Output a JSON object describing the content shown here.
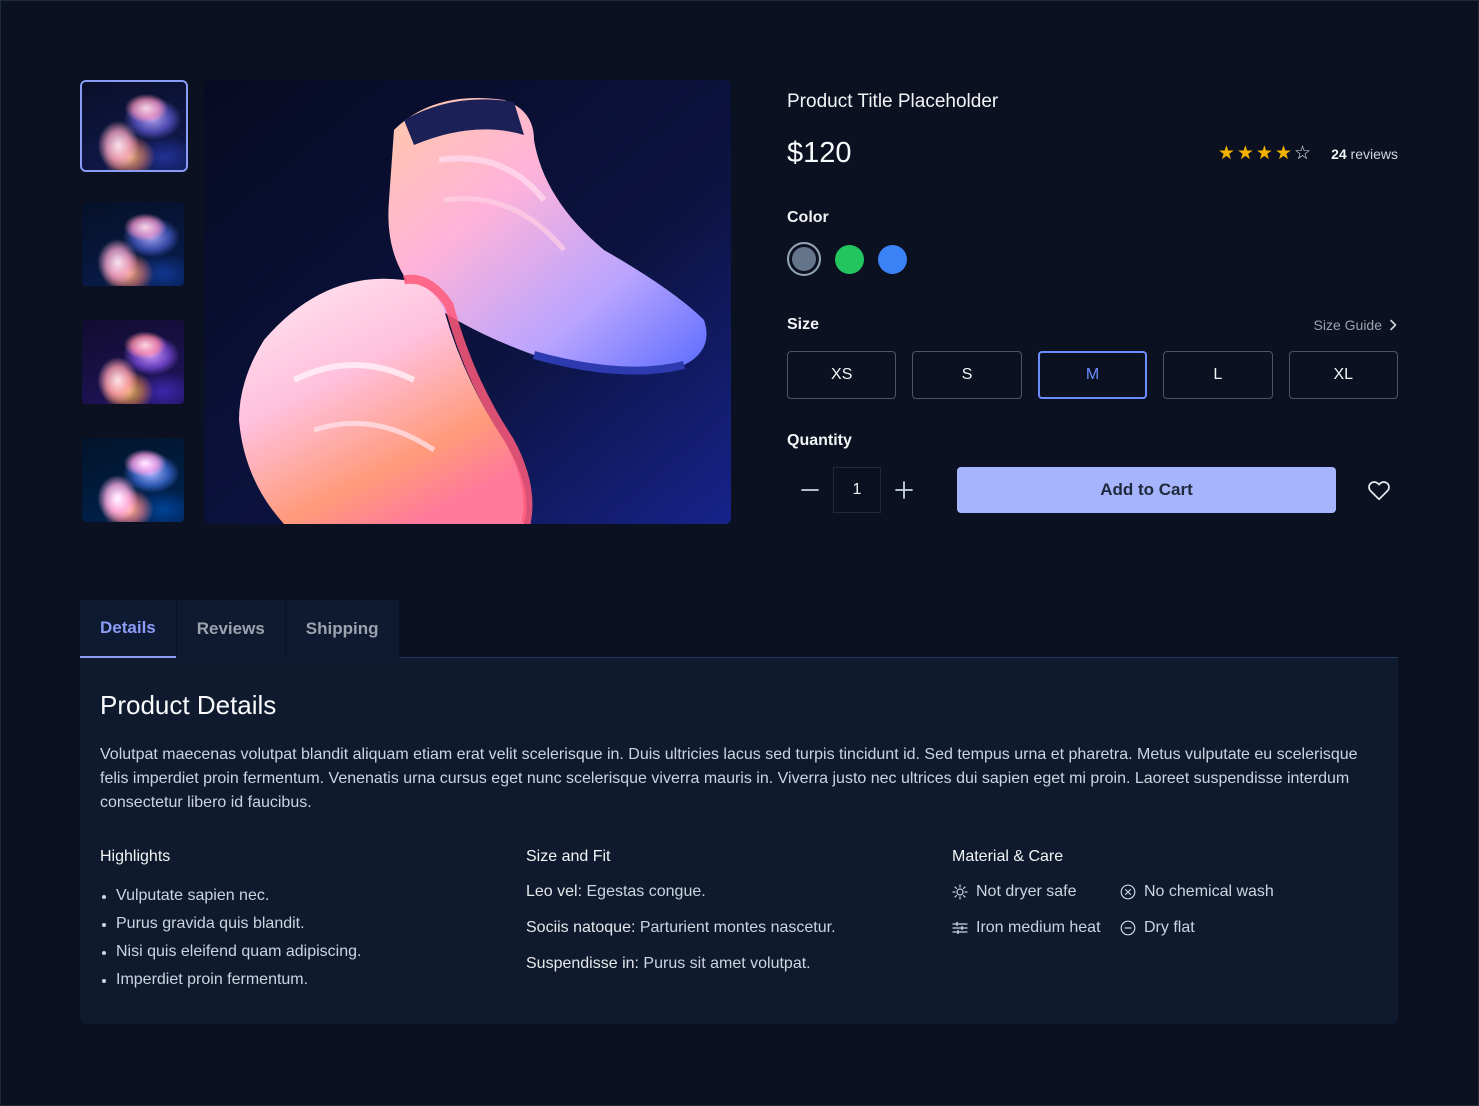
{
  "product": {
    "title": "Product Title Placeholder",
    "price": "$120",
    "rating": 4,
    "rating_max": 5,
    "reviews_count": "24",
    "reviews_label": "reviews"
  },
  "color": {
    "label": "Color",
    "options": [
      {
        "name": "slate",
        "hex": "#64748b",
        "selected": true
      },
      {
        "name": "green",
        "hex": "#22c55e",
        "selected": false
      },
      {
        "name": "blue",
        "hex": "#3b82f6",
        "selected": false
      }
    ]
  },
  "size": {
    "label": "Size",
    "guide_label": "Size Guide",
    "options": [
      "XS",
      "S",
      "M",
      "L",
      "XL"
    ],
    "selected": "M"
  },
  "quantity": {
    "label": "Quantity",
    "value": "1"
  },
  "actions": {
    "add_to_cart": "Add to Cart"
  },
  "tabs": [
    {
      "label": "Details",
      "active": true
    },
    {
      "label": "Reviews",
      "active": false
    },
    {
      "label": "Shipping",
      "active": false
    }
  ],
  "details": {
    "title": "Product Details",
    "description": "Volutpat maecenas volutpat blandit aliquam etiam erat velit scelerisque in. Duis ultricies lacus sed turpis tincidunt id. Sed tempus urna et pharetra. Metus vulputate eu scelerisque felis imperdiet proin fermentum. Venenatis urna cursus eget nunc scelerisque viverra mauris in. Viverra justo nec ultrices dui sapien eget mi proin. Laoreet suspendisse interdum consectetur libero id faucibus.",
    "highlights": {
      "title": "Highlights",
      "items": [
        "Vulputate sapien nec.",
        "Purus gravida quis blandit.",
        "Nisi quis eleifend quam adipiscing.",
        "Imperdiet proin fermentum."
      ]
    },
    "fit": {
      "title": "Size and Fit",
      "items": [
        {
          "key": "Leo vel:",
          "value": " Egestas congue."
        },
        {
          "key": "Sociis natoque:",
          "value": " Parturient montes nascetur."
        },
        {
          "key": "Suspendisse in:",
          "value": " Purus sit amet volutpat."
        }
      ]
    },
    "care": {
      "title": "Material & Care",
      "items": [
        {
          "icon": "sun-icon",
          "label": "Not dryer safe"
        },
        {
          "icon": "x-circle-icon",
          "label": "No chemical wash"
        },
        {
          "icon": "sliders-icon",
          "label": "Iron medium heat"
        },
        {
          "icon": "minus-circle-icon",
          "label": "Dry flat"
        }
      ]
    }
  },
  "colors": {
    "background": "#0b1120",
    "panel": "#0f1a2e",
    "accent": "#8b9cf7",
    "button": "#a5b4fc",
    "star": "#f5b301"
  }
}
